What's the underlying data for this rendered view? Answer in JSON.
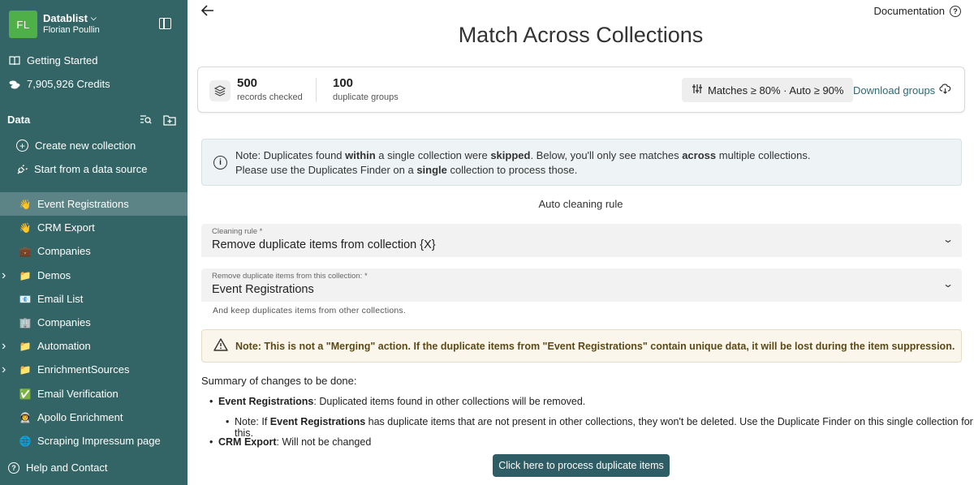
{
  "workspace": {
    "initials": "FL",
    "name": "Datablist",
    "user": "Florian Poullin"
  },
  "sidebar": {
    "getting_started": "Getting Started",
    "credits": "7,905,926 Credits",
    "data_heading": "Data",
    "create_collection": "Create new collection",
    "start_from_source": "Start from a data source",
    "collections": [
      {
        "label": "Event Registrations",
        "icon": "👋",
        "active": true,
        "expandable": false
      },
      {
        "label": "CRM Export",
        "icon": "👋",
        "active": false,
        "expandable": false
      },
      {
        "label": "Companies",
        "icon": "💼",
        "active": false,
        "expandable": false
      },
      {
        "label": "Demos",
        "icon": "📁",
        "active": false,
        "expandable": true
      },
      {
        "label": "Email List",
        "icon": "📧",
        "active": false,
        "expandable": false
      },
      {
        "label": "Companies",
        "icon": "🏢",
        "active": false,
        "expandable": false
      },
      {
        "label": "Automation",
        "icon": "📁",
        "active": false,
        "expandable": true
      },
      {
        "label": "EnrichmentSources",
        "icon": "📁",
        "active": false,
        "expandable": true
      },
      {
        "label": "Email Verification",
        "icon": "✅",
        "active": false,
        "expandable": false
      },
      {
        "label": "Apollo Enrichment",
        "icon": "👨‍🚀",
        "active": false,
        "expandable": false
      },
      {
        "label": "Scraping Impressum page",
        "icon": "🌐",
        "active": false,
        "expandable": false
      }
    ],
    "help": "Help and Contact"
  },
  "header": {
    "documentation": "Documentation",
    "title": "Match Across Collections"
  },
  "stats": {
    "records_value": "500",
    "records_label": "records checked",
    "groups_value": "100",
    "groups_label": "duplicate groups",
    "matches_label": "Matches ≥ 80% · Auto ≥ 90%",
    "download_label": "Download groups"
  },
  "info": {
    "p1": "Note: Duplicates found ",
    "b1": "within",
    "p2": " a single collection were ",
    "b2": "skipped",
    "p3": ". Below, you'll only see matches ",
    "b3": "across",
    "p4": " multiple collections.",
    "l2a": "Please use the Duplicates Finder on a ",
    "l2b": "single",
    "l2c": " collection to process those."
  },
  "rule": {
    "heading": "Auto cleaning rule",
    "cleaning_label": "Cleaning rule *",
    "cleaning_value": "Remove duplicate items from collection {X}",
    "collection_label": "Remove duplicate items from this collection: *",
    "collection_value": "Event Registrations",
    "helper": "And keep duplicates items from other collections."
  },
  "warning": {
    "text": "Note: This is not a \"Merging\" action. If the duplicate items from \"Event Registrations\" contain unique data, it will be lost during the item suppression."
  },
  "summary": {
    "heading": "Summary of changes to be done:",
    "item1_name": "Event Registrations",
    "item1_text": ": Duplicated items found in other collections will be removed.",
    "note_a": "Note: If ",
    "note_b": "Event Registrations",
    "note_c": " has duplicate items that are not present in other collections, they won't be deleted. Use the Duplicate Finder on this single collection for this.",
    "item2_name": "CRM Export",
    "item2_text": ": Will not be changed"
  },
  "process_button": "Click here to process duplicate items",
  "colors": {
    "sidebar_bg": "#336466",
    "sidebar_active": "#5c8385",
    "avatar": "#4fb049",
    "primary_button": "#2f5d66"
  }
}
